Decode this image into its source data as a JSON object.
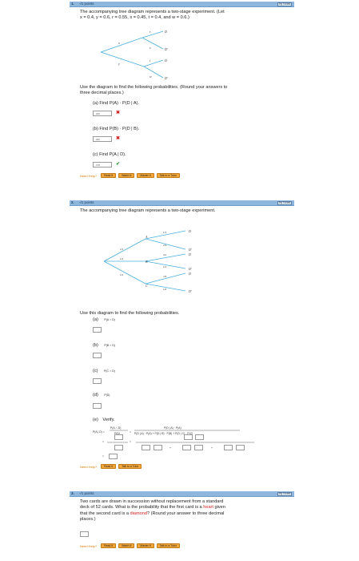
{
  "q1": {
    "number": "1.",
    "points": "-/1 points",
    "mynotes": "My Notes",
    "intro_a": "The accompanying tree diagram represents a two-stage experiment. (Let",
    "intro_b": "x = 0.4, y = 0.6, r = 0.55, s = 0.45, t = 0.4, and w = 0.6.)",
    "tree": {
      "x": "x",
      "y": "y",
      "r": "r",
      "s": "s",
      "t": "t",
      "w": "w",
      "D": "D",
      "D2": "D'",
      "D3": "D",
      "D4": "D'"
    },
    "instr_a": "Use the diagram to find the following probabilities. (Round your answers to",
    "instr_b": "three decimal places.)",
    "parts": [
      {
        "label": "(a) Find P(A) · P(D | A).",
        "value": ".240",
        "mark": "✖"
      },
      {
        "label": "(b) Find P(B) · P(D | B).",
        "value": ".420",
        "mark": "✖"
      },
      {
        "label": "(c) Find P(A | D).",
        "value": ".479",
        "mark": "✔"
      }
    ],
    "help_label": "Need Help?",
    "buttons": [
      "Read It",
      "Watch It",
      "Master It",
      "Talk to a Tutor"
    ]
  },
  "q2": {
    "number": "2.",
    "points": "-/1 points",
    "mynotes": "My Notes",
    "intro": "The accompanying tree diagram represents a two-stage experiment.",
    "tree": {
      "p1": "1/4",
      "p2": "1/4",
      "p3": "1/2",
      "A": "A",
      "B": "B",
      "C": "C",
      "a1": "1/3",
      "a2": "2/3",
      "b1": "3/4",
      "b2": "1/4",
      "c1": "7/8",
      "c2": "1/8",
      "D": "D",
      "Dp": "D'"
    },
    "instr": "Use this diagram to find the following probabilities.",
    "parts": [
      {
        "label": "(a)",
        "expr": "P(A ∩ D)"
      },
      {
        "label": "(b)",
        "expr": "P(B ∩ D)"
      },
      {
        "label": "(c)",
        "expr": "P(C ∩ D)"
      },
      {
        "label": "(d)",
        "expr": "P(D)"
      },
      {
        "label": "(e)",
        "expr": "Verify."
      }
    ],
    "verify": {
      "lhs": "P(A | D) =",
      "frac1_num": "P(A ∩ D)",
      "frac1_den": "P(D)",
      "frac2_num": "P(D | A) · P(A)",
      "frac2_den": "P(D | A) · P(A) + P(D | B) · P(B) + P(D | C) · P(C)",
      "eq": "=",
      "plus": "+"
    },
    "help_label": "Need Help?",
    "buttons": [
      "Read It",
      "Talk to a Tutor"
    ]
  },
  "q3": {
    "number": "3.",
    "points": "-/1 points",
    "mynotes": "My Notes",
    "text_a": "Two cards are drawn in succession without replacement from a standard",
    "text_b1": "deck of 52 cards. What is the probability that the first card is a ",
    "heart": "heart",
    "text_b2": " given",
    "text_c1": "that the second card is a ",
    "diamond": "diamond",
    "text_c2": "? (Round your answer to three decimal",
    "text_d": "places.)",
    "help_label": "Need Help?",
    "buttons": [
      "Read It",
      "Watch It",
      "Master It",
      "Talk to a Tutor"
    ]
  },
  "colors": {
    "branch": "#4ab0dc",
    "header": "#8fb7de",
    "button": "#f2a63a",
    "wrong": "#d21e1e",
    "right": "#2a9a2a"
  }
}
